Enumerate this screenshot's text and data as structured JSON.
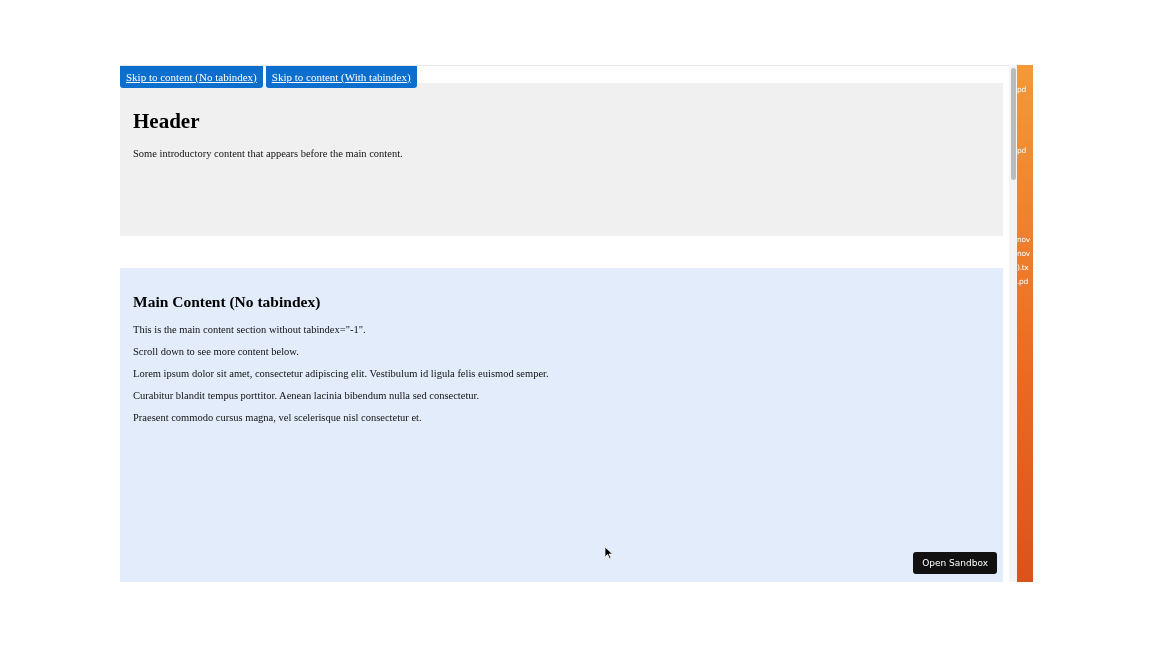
{
  "skip_links": [
    {
      "label": "Skip to content (No tabindex)"
    },
    {
      "label": "Skip to content (With tabindex)"
    }
  ],
  "header": {
    "title": "Header",
    "text": "Some introductory content that appears before the main content."
  },
  "main": {
    "title": "Main Content (No tabindex)",
    "paragraphs": [
      "This is the main content section without tabindex=\"-1\".",
      "Scroll down to see more content below.",
      "Lorem ipsum dolor sit amet, consectetur adipiscing elit. Vestibulum id ligula felis euismod semper.",
      "Curabitur blandit tempus porttitor. Aenean lacinia bibendum nulla sed consectetur.",
      "Praesent commodo cursus magna, vel scelerisque nisl consectetur et."
    ]
  },
  "open_sandbox_button": "Open Sandbox",
  "desktop_labels": [
    {
      "label": "pd"
    },
    {
      "label": "pd"
    },
    {
      "label": "nov"
    },
    {
      "label": "nov"
    },
    {
      "label": ").tx"
    },
    {
      "label": ".pd"
    }
  ]
}
